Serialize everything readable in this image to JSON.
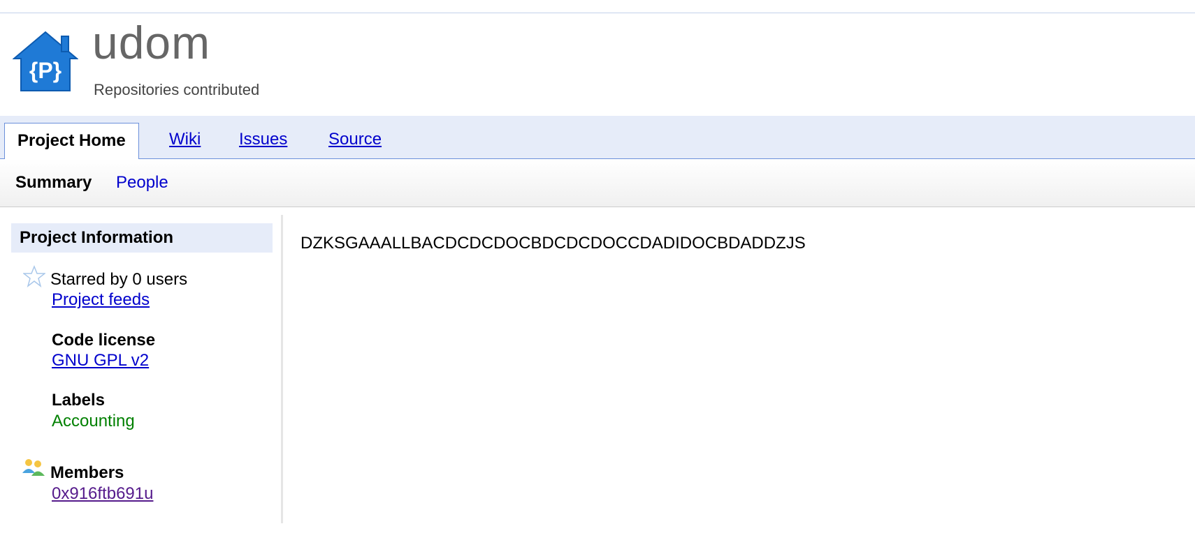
{
  "header": {
    "project_name": "udom",
    "project_summary": "Repositories contributed",
    "logo_icon": "project-hosting-house-icon",
    "logo_text": "{P}"
  },
  "tabs": [
    {
      "label": "Project Home",
      "active": true
    },
    {
      "label": "Wiki",
      "active": false
    },
    {
      "label": "Issues",
      "active": false
    },
    {
      "label": "Source",
      "active": false
    }
  ],
  "subtabs": [
    {
      "label": "Summary",
      "active": true
    },
    {
      "label": "People",
      "active": false
    }
  ],
  "sidebar": {
    "title": "Project Information",
    "starred_text": "Starred by 0 users",
    "star_icon": "star-outline-icon",
    "feeds_link": "Project feeds",
    "license_title": "Code license",
    "license_link": "GNU GPL v2",
    "labels_title": "Labels",
    "labels": [
      "Accounting"
    ],
    "members_title": "Members",
    "members_icon": "members-icon",
    "members": [
      "0x916ftb691u"
    ]
  },
  "main": {
    "description": "DZKSGAAALLBACDCDCDOCBDCDCDOCCDADIDOCBDADDZJS"
  },
  "colors": {
    "link": "#0000cc",
    "visited_link": "#551a8b",
    "label": "#008000",
    "tab_background": "#e6ecf9",
    "tab_border": "#6b90da"
  }
}
